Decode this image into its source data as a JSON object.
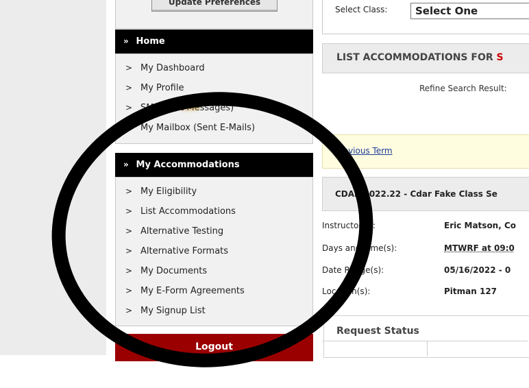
{
  "sidebar": {
    "update_button": "Update Preferences",
    "home_section": {
      "title": "Home",
      "items": [
        "My Dashboard",
        "My Profile",
        "SMS (Text Messages)",
        "My Mailbox (Sent E-Mails)"
      ]
    },
    "accommodations_section": {
      "title": "My Accommodations",
      "items": [
        "My Eligibility",
        "List Accommodations",
        "Alternative Testing",
        "Alternative Formats",
        "My Documents",
        "My E-Form Agreements",
        "My Signup List"
      ]
    },
    "logout_label": "Logout"
  },
  "main": {
    "select_class_label": "Select Class:",
    "select_class_value": "Select One",
    "list_heading": "LIST ACCOMMODATIONS FOR",
    "list_heading_red": "S",
    "refine_label": "Refine Search Result:",
    "previous_term": "Previous Term",
    "class_title": "CDAR 2022.22 - Cdar Fake Class Se",
    "info": [
      {
        "label": "Instructor(s):",
        "value": "Eric Matson, Co"
      },
      {
        "label": "Days and Time(s):",
        "value": "MTWRF at 09:0"
      },
      {
        "label": "Date Range(s):",
        "value": "05/16/2022 - 0"
      },
      {
        "label": "Location(s):",
        "value": "Pitman 127"
      }
    ],
    "request_status": "Request Status"
  },
  "icons": {
    "section_chevron": "double-chevron-down-icon",
    "nav_arrow": "chevron-right-icon"
  },
  "colors": {
    "section_header": "#000000",
    "logout": "#9b0000",
    "previous_term_bg": "#fffde0",
    "link": "#1a3a9a",
    "annotation_circle": "#000000"
  }
}
